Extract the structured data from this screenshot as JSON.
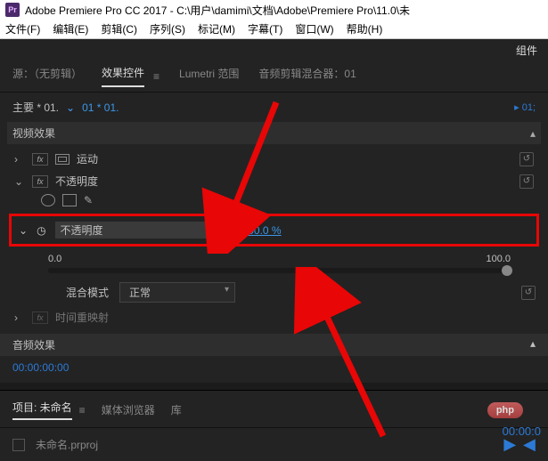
{
  "titlebar": {
    "app_name": "Adobe Premiere Pro CC 2017",
    "path": "C:\\用户\\damimi\\文档\\Adobe\\Premiere Pro\\11.0\\未",
    "logo_text": "Pr"
  },
  "menubar": {
    "file": "文件(F)",
    "edit": "编辑(E)",
    "clip": "剪辑(C)",
    "sequence": "序列(S)",
    "marker": "标记(M)",
    "title": "字幕(T)",
    "window": "窗口(W)",
    "help": "帮助(H)"
  },
  "workspace_label": "组件",
  "source_tabs": {
    "source": "源：（无剪辑）",
    "effects": "效果控件",
    "lumetri": "Lumetri 范围",
    "audio_mixer": "音频剪辑混合器：01"
  },
  "clip_header": {
    "master": "主要 * 01.",
    "instance": "01 * 01."
  },
  "timeline_marker": "01;",
  "sections": {
    "video_effects": "视频效果",
    "audio_effects": "音频效果"
  },
  "fx": {
    "motion": "运动",
    "opacity": "不透明度",
    "time_remap": "时间重映射",
    "fx_badge": "fx"
  },
  "opacity_prop": {
    "label": "不透明度",
    "value": "100.0 %",
    "min": "0.0",
    "max": "100.0"
  },
  "blend_mode": {
    "label": "混合模式",
    "value": "正常"
  },
  "timecode": "00:00:00:00",
  "timecode2": "00:00:0",
  "project": {
    "tab_project": "项目: 未命名",
    "tab_media": "媒体浏览器",
    "tab_lib": "库",
    "filename": "未命名.prproj"
  },
  "watermark": "php",
  "colors": {
    "highlight": "#e80606",
    "link_blue": "#3b97e8",
    "timecode_blue": "#2c7ad6"
  }
}
